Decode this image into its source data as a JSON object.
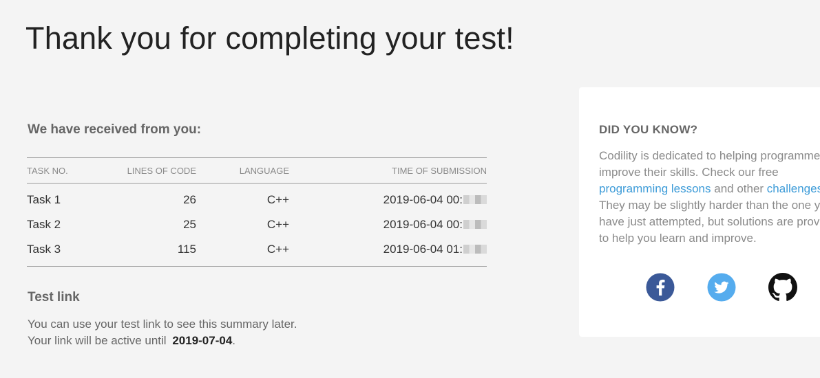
{
  "page": {
    "title": "Thank you for completing your test!"
  },
  "received": {
    "heading": "We have received from you:",
    "columns": {
      "task": "TASK NO.",
      "lines": "LINES OF CODE",
      "language": "LANGUAGE",
      "time": "TIME OF SUBMISSION"
    },
    "rows": [
      {
        "task": "Task 1",
        "lines": "26",
        "language": "C++",
        "time": "2019-06-04 00:"
      },
      {
        "task": "Task 2",
        "lines": "25",
        "language": "C++",
        "time": "2019-06-04 00:"
      },
      {
        "task": "Task 3",
        "lines": "115",
        "language": "C++",
        "time": "2019-06-04 01:"
      }
    ]
  },
  "test_link": {
    "heading": "Test link",
    "line1": "You can use your test link to see this summary later.",
    "line2_prefix": "Your link will be active until",
    "active_until": "2019-07-04",
    "line2_suffix": "."
  },
  "did_you_know": {
    "heading": "DID YOU KNOW?",
    "line1": "Codility is dedicated to helping programmers",
    "line2": "improve their skills. Check our free",
    "lessons_link": "programming lessons",
    "and_other": " and other ",
    "challenges_link": "challenges",
    "line4": "They may be slightly harder than the one you",
    "line5": "have just attempted, but solutions are provided",
    "line6": "to help you learn and improve."
  },
  "social": {
    "icons": [
      "facebook-icon",
      "twitter-icon",
      "github-icon"
    ]
  },
  "colors": {
    "background": "#f4f4f4",
    "link": "#3c9bd8",
    "facebook": "#3b5998",
    "twitter": "#55acee",
    "github": "#111111"
  }
}
